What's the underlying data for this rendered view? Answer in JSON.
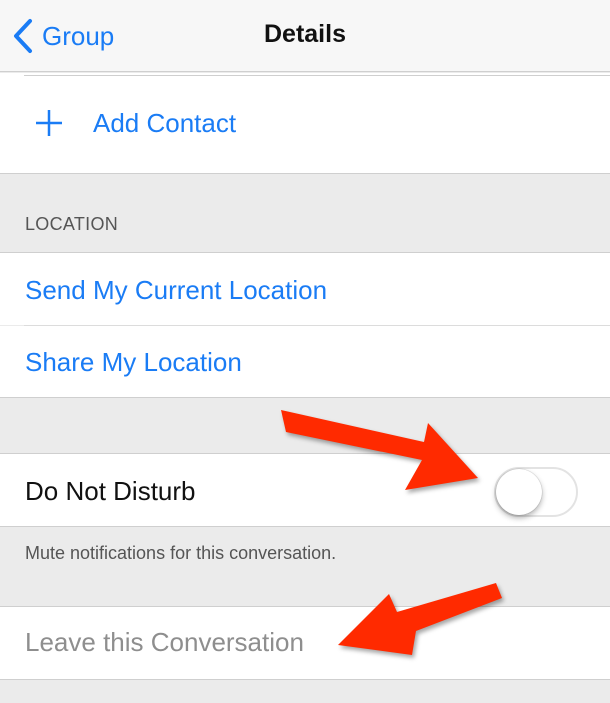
{
  "navbar": {
    "back_label": "Group",
    "title": "Details"
  },
  "add_contact": {
    "icon": "plus-icon",
    "label": "Add Contact"
  },
  "location_section": {
    "header": "LOCATION",
    "items": [
      {
        "label": "Send My Current Location"
      },
      {
        "label": "Share My Location"
      }
    ]
  },
  "do_not_disturb": {
    "label": "Do Not Disturb",
    "enabled": false,
    "footer": "Mute notifications for this conversation."
  },
  "leave": {
    "label": "Leave this Conversation",
    "disabled": true
  },
  "annotations": {
    "arrow_color": "#ff2a00",
    "arrows": [
      "points-to-do-not-disturb-toggle",
      "points-to-leave-conversation"
    ]
  },
  "colors": {
    "accent": "#1a7cf5",
    "disabled_text": "#8e8e8e",
    "group_background": "#ebebeb"
  }
}
